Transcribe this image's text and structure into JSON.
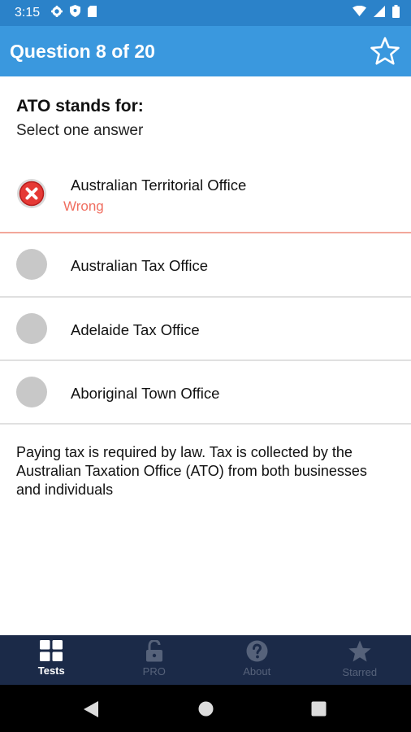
{
  "status_bar": {
    "time": "3:15"
  },
  "header": {
    "title": "Question 8 of 20"
  },
  "question": {
    "text": "ATO stands for:",
    "instruction": "Select one answer"
  },
  "options": [
    {
      "label": "Australian Territorial Office",
      "state": "wrong",
      "feedback": "Wrong"
    },
    {
      "label": "Australian Tax Office"
    },
    {
      "label": "Adelaide Tax Office"
    },
    {
      "label": "Aboriginal Town Office"
    }
  ],
  "explanation": "Paying tax is required by law. Tax is collected by the Australian Taxation Office (ATO) from both businesses and individuals",
  "bottom_nav": {
    "tabs": [
      {
        "label": "Tests",
        "icon": "grid-icon",
        "active": true
      },
      {
        "label": "PRO",
        "icon": "unlock-icon",
        "active": false
      },
      {
        "label": "About",
        "icon": "help-icon",
        "active": false
      },
      {
        "label": "Starred",
        "icon": "star-icon",
        "active": false
      }
    ]
  },
  "colors": {
    "header": "#3a98de",
    "status_bar": "#2b82c9",
    "wrong": "#f06e60",
    "nav": "#1b2a48"
  }
}
